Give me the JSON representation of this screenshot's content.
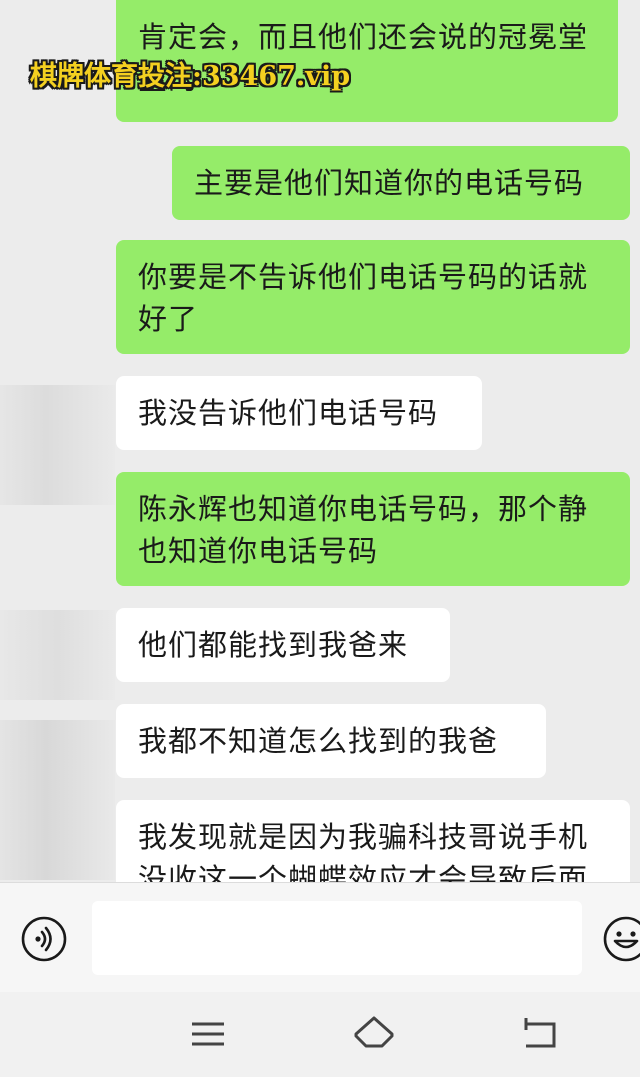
{
  "watermark": "棋牌体育投注:33467.vip",
  "messages": [
    {
      "side": "right",
      "text": "肯定会，而且他们还会说的冠冕堂皇的"
    },
    {
      "side": "right",
      "text": "主要是他们知道你的电话号码"
    },
    {
      "side": "right",
      "text": "你要是不告诉他们电话号码的话就好了"
    },
    {
      "side": "left",
      "text": "我没告诉他们电话号码"
    },
    {
      "side": "right",
      "text": "陈永辉也知道你电话号码，那个静也知道你电话号码"
    },
    {
      "side": "left",
      "text": "他们都能找到我爸来"
    },
    {
      "side": "left",
      "text": "我都不知道怎么找到的我爸"
    },
    {
      "side": "left",
      "text": "我发现就是因为我骗科技哥说手机没收这一个蝴蝶效应才会导致后面"
    }
  ],
  "input": {
    "value": ""
  },
  "icons": {
    "voice": "voice-icon",
    "emoji": "emoji-icon",
    "menu": "menu-icon",
    "home": "home-icon",
    "back": "back-icon"
  },
  "colors": {
    "sent_bubble": "#95ec69",
    "received_bubble": "#ffffff",
    "background": "#ededed"
  }
}
